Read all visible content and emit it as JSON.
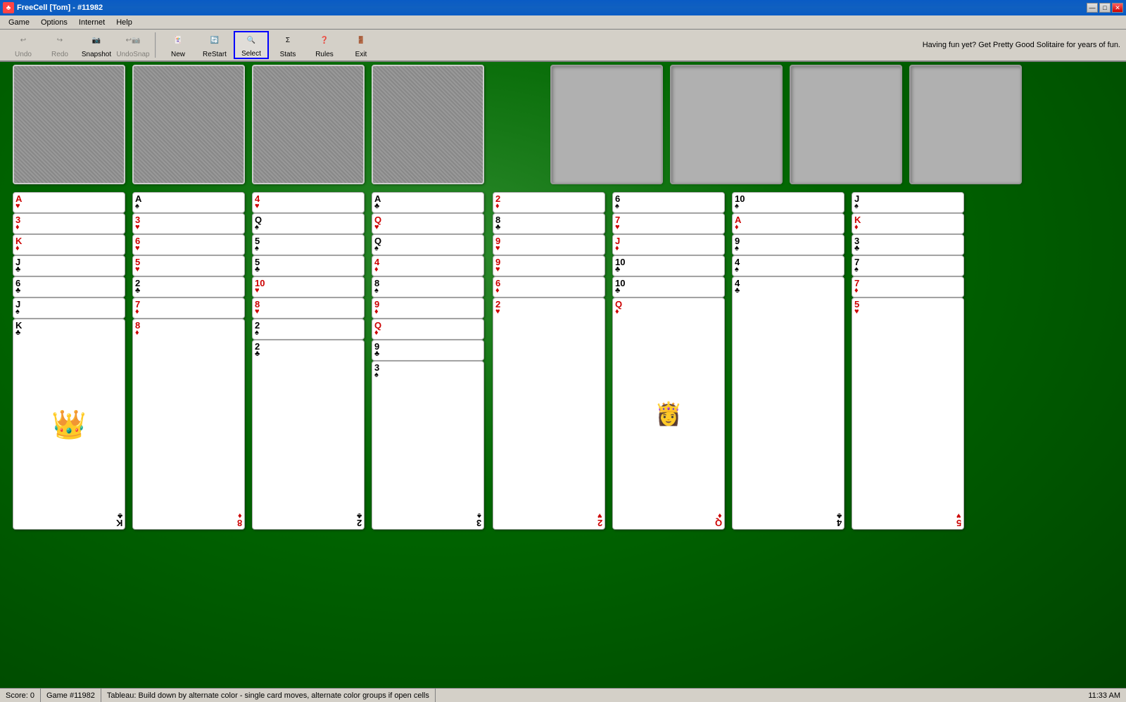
{
  "window": {
    "title": "FreeCell [Tom] - #11982",
    "icon": "♣"
  },
  "titleButtons": {
    "minimize": "—",
    "maximize": "□",
    "close": "✕"
  },
  "menu": {
    "items": [
      "Game",
      "Options",
      "Internet",
      "Help"
    ]
  },
  "toolbar": {
    "undo_label": "Undo",
    "redo_label": "Redo",
    "snapshot_label": "Snapshot",
    "undosnap_label": "UndoSnap",
    "new_label": "New",
    "restart_label": "ReStart",
    "select_label": "Select",
    "stats_label": "Stats",
    "rules_label": "Rules",
    "exit_label": "Exit"
  },
  "ad": {
    "text": "Having fun yet?  Get Pretty Good Solitaire for years of fun."
  },
  "status": {
    "score": "Score: 0",
    "game": "Game #11982",
    "tableau": "Tableau: Build down by alternate color - single card moves, alternate color groups if open cells",
    "time": "11:33 AM"
  }
}
